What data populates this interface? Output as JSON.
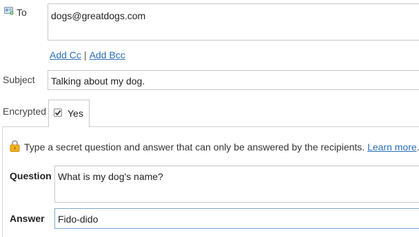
{
  "to": {
    "label": "To",
    "value": "dogs@greatdogs.com",
    "icon": "contact-card-icon"
  },
  "recipients": {
    "add_cc": "Add Cc",
    "separator": "|",
    "add_bcc": "Add Bcc"
  },
  "subject": {
    "label": "Subject",
    "value": "Talking about my dog."
  },
  "encrypted": {
    "label": "Encrypted",
    "checked": true,
    "option_label": "Yes"
  },
  "secret": {
    "lock_icon": "lock-icon",
    "info_text": "Type a secret question and answer that can only be answered by the recipients.",
    "learn_more": "Learn more",
    "period": ".",
    "question_label": "Question",
    "question_value": "What is my dog's name?",
    "answer_label": "Answer",
    "answer_value": "Fido-dido"
  },
  "colors": {
    "link": "#2a6ebb",
    "border": "#c8c8c8",
    "focus_border": "#7aa7d6"
  }
}
